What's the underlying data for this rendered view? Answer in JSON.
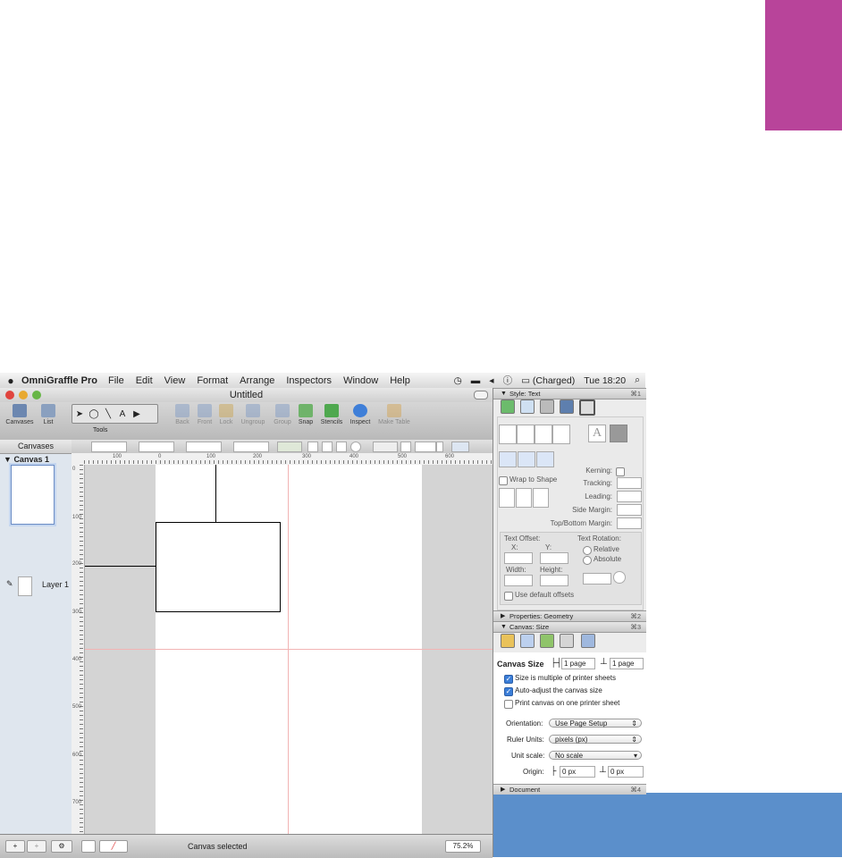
{
  "menubar": {
    "apple": "",
    "app_name": "OmniGraffle Pro",
    "items": [
      "File",
      "Edit",
      "View",
      "Format",
      "Arrange",
      "Inspectors",
      "Window",
      "Help"
    ],
    "battery": "(Charged)",
    "clock": "Tue 18:20",
    "search_icon": "⌕"
  },
  "window": {
    "title": "Untitled",
    "toolbar": {
      "canvases": "Canvases",
      "list": "List",
      "tools": "Tools",
      "back": "Back",
      "front": "Front",
      "lock": "Lock",
      "ungroup": "Ungroup",
      "group": "Group",
      "snap": "Snap",
      "stencils": "Stencils",
      "inspect": "Inspect",
      "make_table": "Make Table"
    },
    "sidebar": {
      "header": "Canvases",
      "canvas_name": "Canvas 1",
      "layer_name": "Layer 1"
    },
    "ruler_h_ticks": [
      "100",
      "0",
      "100",
      "200",
      "300",
      "400",
      "500",
      "600"
    ],
    "ruler_v_ticks": [
      "0",
      "100",
      "200",
      "300",
      "400",
      "500",
      "600",
      "700"
    ],
    "status": {
      "text": "Canvas selected",
      "zoom": "75.2%"
    }
  },
  "inspector": {
    "style_text": {
      "title": "Style: Text",
      "shortcut": "⌘1"
    },
    "text_labels": {
      "wrap_to_shape": "Wrap to Shape",
      "kerning": "Kerning:",
      "tracking": "Tracking:",
      "leading": "Leading:",
      "side_margin": "Side Margin:",
      "top_bottom_margin": "Top/Bottom Margin:",
      "text_offset": "Text Offset:",
      "x": "X:",
      "y": "Y:",
      "width": "Width:",
      "height": "Height:",
      "text_rotation": "Text Rotation:",
      "relative": "Relative",
      "absolute": "Absolute",
      "use_default_offsets": "Use default offsets"
    },
    "properties_geometry": {
      "title": "Properties: Geometry",
      "shortcut": "⌘2"
    },
    "canvas_size_section": {
      "title": "Canvas: Size",
      "shortcut": "⌘3"
    },
    "canvas_size": {
      "label": "Canvas Size",
      "width": "1 page",
      "height": "1 page",
      "multiple_of_sheets": "Size is multiple of printer sheets",
      "auto_adjust": "Auto-adjust the canvas size",
      "print_one_sheet": "Print canvas on one printer sheet",
      "orientation_label": "Orientation:",
      "orientation_value": "Use Page Setup",
      "ruler_units_label": "Ruler Units:",
      "ruler_units_value": "pixels (px)",
      "unit_scale_label": "Unit scale:",
      "unit_scale_value": "No scale",
      "origin_label": "Origin:",
      "origin_x": "0 px",
      "origin_y": "0 px"
    },
    "document": {
      "title": "Document",
      "shortcut": "⌘4"
    }
  },
  "colors": {
    "magenta_block": "#b8449a",
    "desktop_blue": "#5b8fcb",
    "accent": "#3b7ed8"
  }
}
